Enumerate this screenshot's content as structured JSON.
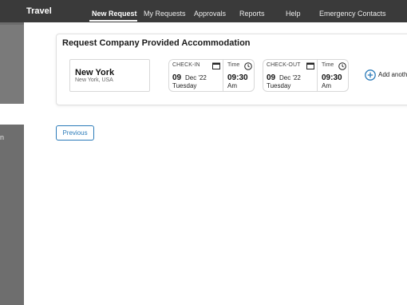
{
  "sidebar": {
    "fragment_text": "n"
  },
  "nav": {
    "brand": "Travel",
    "items": [
      {
        "label": "New Request",
        "active": true
      },
      {
        "label": "My Requests",
        "active": false
      },
      {
        "label": "Approvals",
        "active": false
      },
      {
        "label": "Reports",
        "active": false
      },
      {
        "label": "Help",
        "active": false
      },
      {
        "label": "Emergency Contacts",
        "active": false
      }
    ]
  },
  "accommodation": {
    "title": "Request Company Provided Accommodation",
    "city": {
      "name": "New York",
      "subtitle": "New York, USA"
    },
    "checkin": {
      "label": "CHECK-IN",
      "day": "09",
      "month": "Dec '22",
      "weekday": "Tuesday",
      "time_label": "Time",
      "time": "09:30",
      "ampm": "Am"
    },
    "checkout": {
      "label": "CHECK-OUT",
      "day": "09",
      "month": "Dec '22",
      "weekday": "Tuesday",
      "time_label": "Time",
      "time": "09:30",
      "ampm": "Am"
    },
    "add_more_label": "Add anoth"
  },
  "footer": {
    "previous_label": "Previous"
  },
  "colors": {
    "nav_bg": "#3a3a3a",
    "sidebar_bg": "#6e6e6e",
    "accent": "#2b7bb9"
  }
}
